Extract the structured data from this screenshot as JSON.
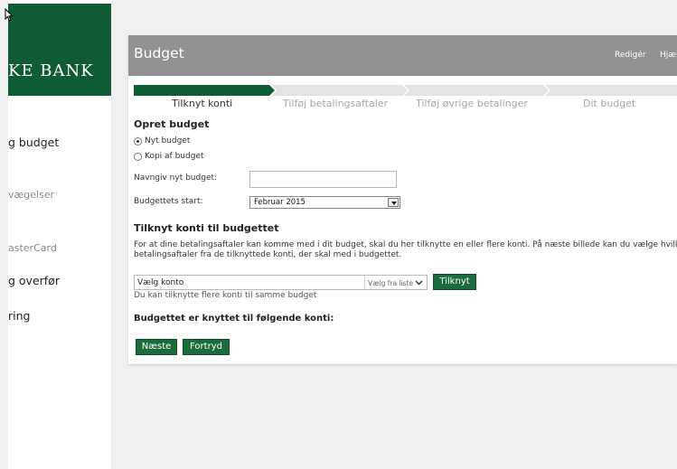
{
  "brand": {
    "name": "KE BANK"
  },
  "sidebar": {
    "items": [
      {
        "label": "g budget"
      },
      {
        "label": "vægelser"
      },
      {
        "label": "asterCard"
      },
      {
        "label": "g overfør"
      },
      {
        "label": "ring"
      }
    ]
  },
  "panel": {
    "title": "Budget",
    "header_links": {
      "edit": "Redigér",
      "help": "Hjæl"
    }
  },
  "steps": [
    {
      "label": "Tilknyt konti",
      "active": true
    },
    {
      "label": "Tilføj betalingsaftaler",
      "active": false
    },
    {
      "label": "Tilføj øvrige betalinger",
      "active": false
    },
    {
      "label": "Dit budget",
      "active": false
    }
  ],
  "create": {
    "heading": "Opret budget",
    "options": [
      {
        "label": "Nyt budget",
        "checked": true
      },
      {
        "label": "Kopi af budget",
        "checked": false
      }
    ],
    "name_label": "Navngiv nyt budget:",
    "name_value": "",
    "start_label": "Budgettets start:",
    "start_value": "Februar 2015"
  },
  "link_accounts": {
    "heading": "Tilknyt konti til budgettet",
    "description_line1": "For at dine betalingsaftaler kan komme med i dit budget, skal du her tilknytte en eller flere konti. På næste billede kan du vælge hvilke",
    "description_line2": "betalingsaftaler fra de tilknyttede konti, der skal med i budgettet.",
    "account_placeholder": "Vælg konto",
    "select_hint": "Vælg fra liste",
    "link_button": "Tilknyt",
    "multi_hint": "Du kan tilknytte flere konti til samme budget",
    "linked_heading": "Budgettet er knyttet til følgende konti:"
  },
  "actions": {
    "next": "Næste",
    "cancel": "Fortryd"
  },
  "colors": {
    "brand_green": "#0f5b34",
    "button_green": "#1b6b3c",
    "header_grey": "#929292",
    "progress_dark": "#0f5b34",
    "progress_light": "#e3e3e3"
  }
}
